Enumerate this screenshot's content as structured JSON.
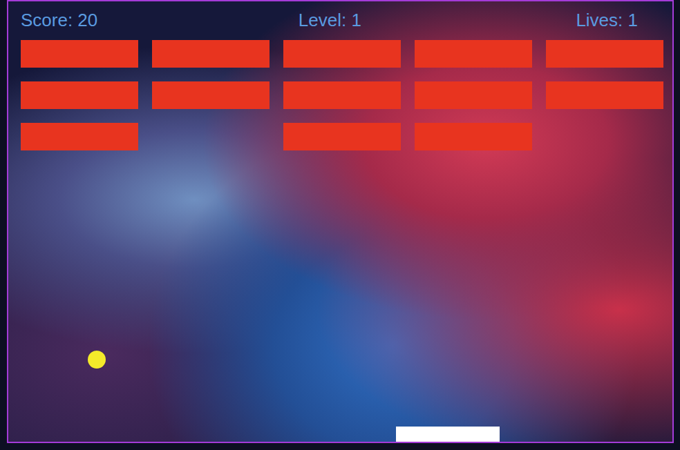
{
  "hud": {
    "score": "Score: 20",
    "level": "Level: 1",
    "lives": "Lives: 1"
  },
  "bricks": [
    [
      {
        "visible": true
      },
      {
        "visible": true
      },
      {
        "visible": true
      },
      {
        "visible": true
      },
      {
        "visible": true
      }
    ],
    [
      {
        "visible": true
      },
      {
        "visible": true
      },
      {
        "visible": true
      },
      {
        "visible": true
      },
      {
        "visible": true
      }
    ],
    [
      {
        "visible": true
      },
      {
        "visible": false
      },
      {
        "visible": true
      },
      {
        "visible": true
      },
      {
        "visible": false
      }
    ]
  ]
}
